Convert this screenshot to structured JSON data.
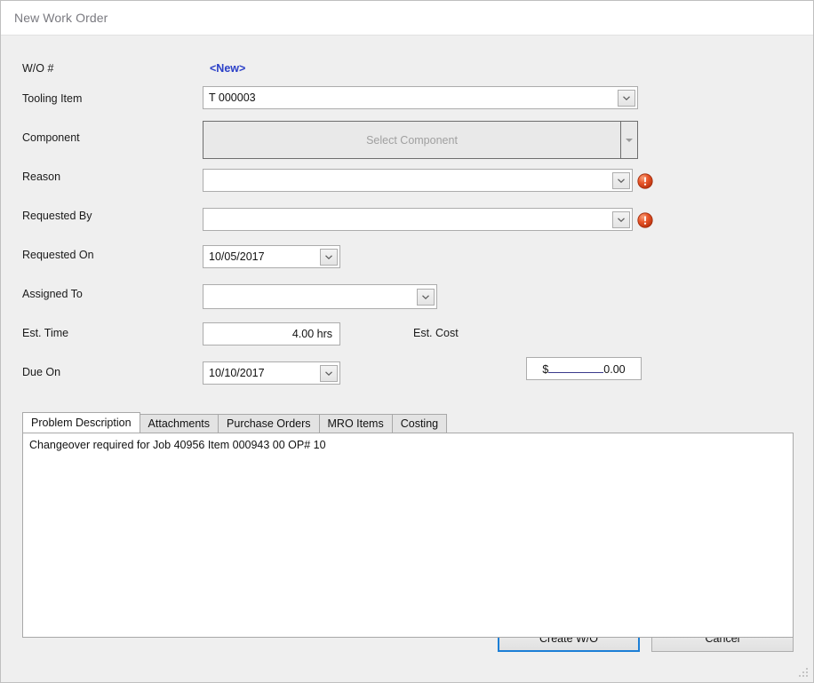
{
  "window": {
    "title": "New Work Order"
  },
  "form": {
    "wo_number": {
      "label": "W/O #",
      "value": "<New>"
    },
    "tooling_item": {
      "label": "Tooling Item",
      "value": "T 000003"
    },
    "component": {
      "label": "Component",
      "placeholder": "Select Component",
      "value": ""
    },
    "reason": {
      "label": "Reason",
      "value": "",
      "error": true
    },
    "requested_by": {
      "label": "Requested By",
      "value": "",
      "error": true
    },
    "requested_on": {
      "label": "Requested On",
      "value": "10/05/2017"
    },
    "assigned_to": {
      "label": "Assigned To",
      "value": ""
    },
    "est_time": {
      "label": "Est. Time",
      "value": "4.00 hrs"
    },
    "est_cost": {
      "label": "Est. Cost",
      "currency": "$",
      "value": "0.00"
    },
    "due_on": {
      "label": "Due On",
      "value": "10/10/2017"
    }
  },
  "tabs": [
    {
      "label": "Problem Description",
      "active": true
    },
    {
      "label": "Attachments",
      "active": false
    },
    {
      "label": "Purchase Orders",
      "active": false
    },
    {
      "label": "MRO Items",
      "active": false
    },
    {
      "label": "Costing",
      "active": false
    }
  ],
  "problem_description": {
    "text": "Changeover required for Job 40956 Item 000943 00 OP# 10"
  },
  "buttons": {
    "create": "Create W/O",
    "cancel": "Cancel"
  },
  "colors": {
    "window_bg": "#efefef",
    "titlebar_bg": "#ffffff",
    "title_text": "#7a7a80",
    "accent_blue": "#2b40c8",
    "focus_blue": "#1c7fd6",
    "error_red": "#e04a1e",
    "field_border": "#acacac"
  },
  "icons": {
    "dropdown": "chevron-down-icon",
    "error": "error-icon",
    "resize": "resize-grip-icon"
  }
}
